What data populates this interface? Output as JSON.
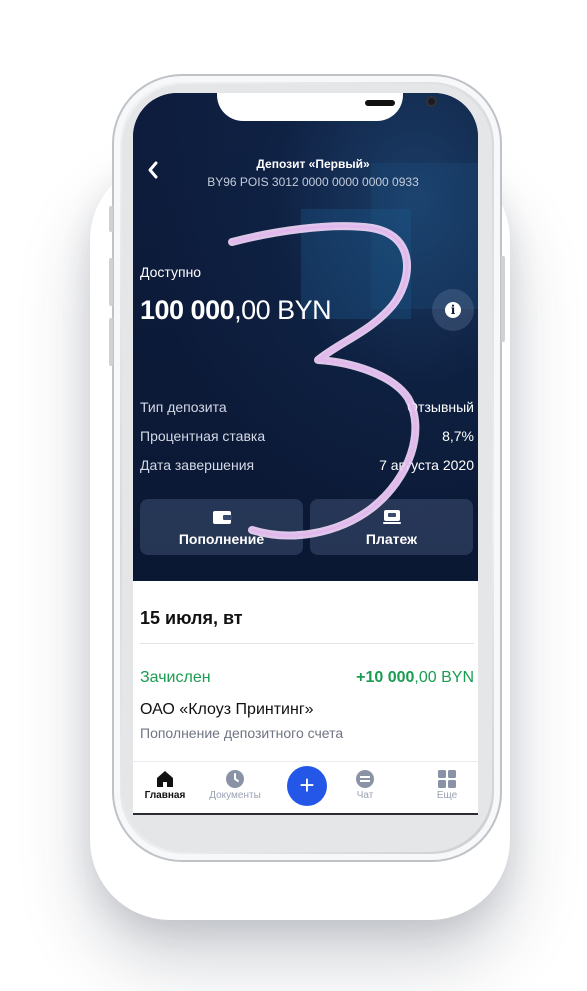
{
  "header": {
    "title": "Депозит «Первый»",
    "account": "BY96 POIS 3012 0000 0000 0000 0933"
  },
  "balance": {
    "label": "Доступно",
    "amount_int": "100 000",
    "amount_frac": ",00 BYN"
  },
  "details": [
    {
      "label": "Тип депозита",
      "value": "Отзывный"
    },
    {
      "label": "Процентная ставка",
      "value": "8,7%"
    },
    {
      "label": "Дата завершения",
      "value": "7 августа 2020"
    }
  ],
  "actions": {
    "topup_label": "Пополнение",
    "payment_label": "Платеж"
  },
  "transactions": {
    "date": "15 июля, вт",
    "items": [
      {
        "status": "Зачислен",
        "amount_int": "+10 000",
        "amount_frac": ",00 BYN",
        "name": "ОАО «Клоуз Принтинг»",
        "description": "Пополнение депозитного счета"
      }
    ]
  },
  "tabbar": {
    "tabs": [
      {
        "label": "Главная",
        "icon": "home-icon",
        "active": true
      },
      {
        "label": "Документы",
        "icon": "clock-icon",
        "active": false
      },
      {
        "label": "",
        "icon": "plus-icon",
        "active": false
      },
      {
        "label": "Чат",
        "icon": "chat-icon",
        "active": false
      },
      {
        "label": "Еще",
        "icon": "grid-icon",
        "active": false
      }
    ],
    "fab_symbol": "+"
  },
  "overlay": {
    "annotation": "3",
    "annotation_color": "#e6c6ee"
  },
  "colors": {
    "background_dark": "#0c1a3a",
    "accent_blue": "#2457e8",
    "positive_green": "#1a9c52"
  }
}
